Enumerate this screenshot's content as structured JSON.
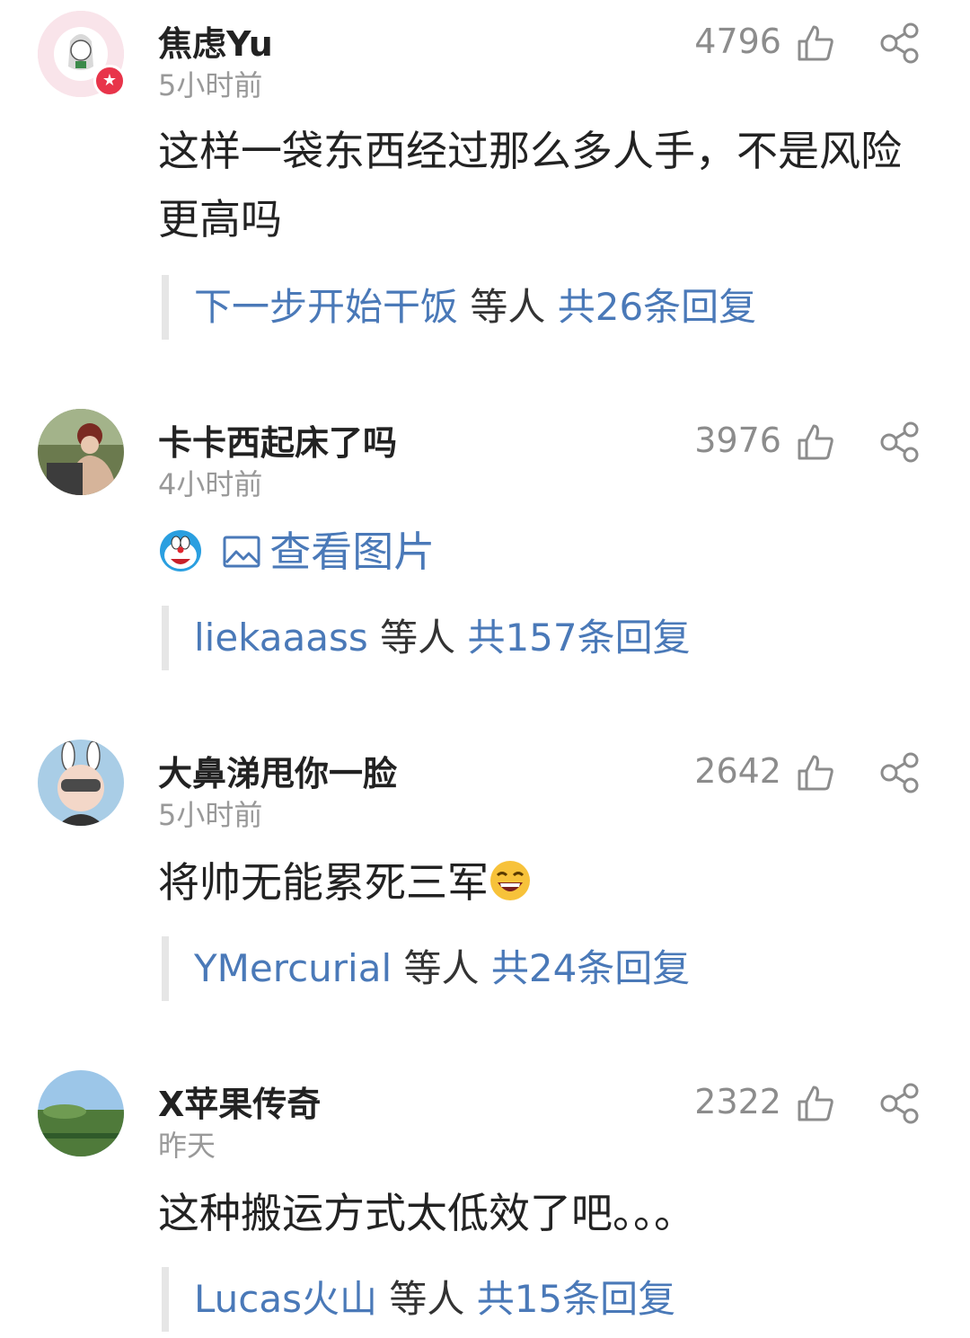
{
  "comments": [
    {
      "user": "焦虑Yu",
      "time": "5小时前",
      "likes": "4796",
      "text": "这样一袋东西经过那么多人手，不是风险更高吗",
      "reply_names": "下一步开始干饭",
      "reply_mid": " 等人 ",
      "reply_count": "共26条回复",
      "vip": true,
      "avatar_colors": [
        "#f7dbe3",
        "#ffffff"
      ]
    },
    {
      "user": "卡卡西起床了吗",
      "time": "4小时前",
      "likes": "3976",
      "pic_label": "查看图片",
      "reply_names": "liekaaass",
      "reply_mid": " 等人 ",
      "reply_count": "共157条回复",
      "avatar_colors": [
        "#6b7a4e",
        "#c9a58c"
      ]
    },
    {
      "user": "大鼻涕甩你一脸",
      "time": "5小时前",
      "likes": "2642",
      "text": "将帅无能累死三军",
      "reply_names": "YMercurial",
      "reply_mid": " 等人 ",
      "reply_count": "共24条回复",
      "avatar_colors": [
        "#a9cde6",
        "#f3d7c8"
      ]
    },
    {
      "user": "X苹果传奇",
      "time": "昨天",
      "likes": "2322",
      "text": "这种搬运方式太低效了吧。。。",
      "reply_names": "Lucas火山",
      "reply_mid": " 等人 ",
      "reply_count": "共15条回复",
      "avatar_colors": [
        "#9cc6e8",
        "#4f7a3a"
      ]
    }
  ],
  "colors": {
    "link": "#4a79b8",
    "username": "#222222",
    "meta": "#999999",
    "vip_badge": "#e8344a"
  },
  "icons": {
    "like": "thumbs-up-outline",
    "share": "share-nodes",
    "pic": "image-outline",
    "laugh_emoji": "laughing-face",
    "doraemon_emoji": "doraemon-face"
  }
}
